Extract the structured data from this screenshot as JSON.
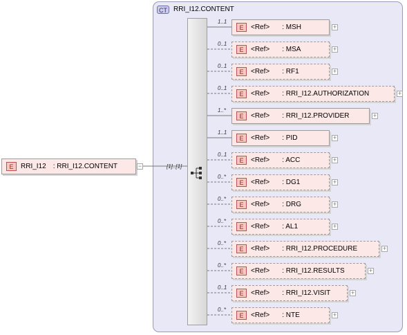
{
  "complex_type": {
    "badge": "CT",
    "name": "RRI_I12.CONTENT"
  },
  "root": {
    "badge": "E",
    "name": "RRI_I12",
    "type": ": RRI_I12.CONTENT",
    "cardinality": "[1]..[1]",
    "collapse": "−"
  },
  "expand_glyph": "+",
  "children": [
    {
      "badge": "E",
      "ref": "<Ref>",
      "name": ": MSH",
      "card": "1..1",
      "optional": false
    },
    {
      "badge": "E",
      "ref": "<Ref>",
      "name": ": MSA",
      "card": "0..1",
      "optional": true
    },
    {
      "badge": "E",
      "ref": "<Ref>",
      "name": ": RF1",
      "card": "0..1",
      "optional": true
    },
    {
      "badge": "E",
      "ref": "<Ref>",
      "name": ": RRI_I12.AUTHORIZATION",
      "card": "0..1",
      "optional": true
    },
    {
      "badge": "E",
      "ref": "<Ref>",
      "name": ": RRI_I12.PROVIDER",
      "card": "1..*",
      "optional": false
    },
    {
      "badge": "E",
      "ref": "<Ref>",
      "name": ": PID",
      "card": "1..1",
      "optional": false
    },
    {
      "badge": "E",
      "ref": "<Ref>",
      "name": ": ACC",
      "card": "0..1",
      "optional": true
    },
    {
      "badge": "E",
      "ref": "<Ref>",
      "name": ": DG1",
      "card": "0..*",
      "optional": true
    },
    {
      "badge": "E",
      "ref": "<Ref>",
      "name": ": DRG",
      "card": "0..*",
      "optional": true
    },
    {
      "badge": "E",
      "ref": "<Ref>",
      "name": ": AL1",
      "card": "0..*",
      "optional": true
    },
    {
      "badge": "E",
      "ref": "<Ref>",
      "name": ": RRI_I12.PROCEDURE",
      "card": "0..*",
      "optional": true
    },
    {
      "badge": "E",
      "ref": "<Ref>",
      "name": ": RRI_I12.RESULTS",
      "card": "0..*",
      "optional": true
    },
    {
      "badge": "E",
      "ref": "<Ref>",
      "name": ": RRI_I12.VISIT",
      "card": "0..1",
      "optional": true
    },
    {
      "badge": "E",
      "ref": "<Ref>",
      "name": ": NTE",
      "card": "0..*",
      "optional": true
    }
  ]
}
